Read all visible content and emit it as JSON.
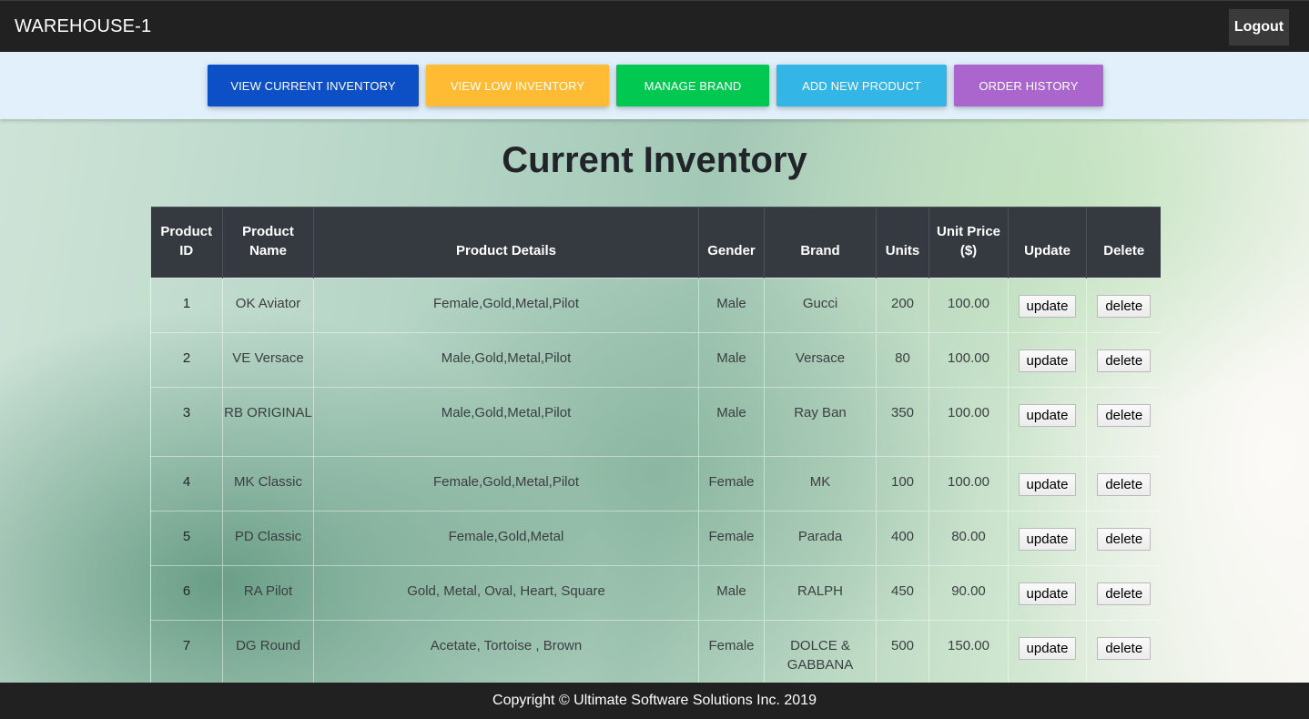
{
  "header": {
    "brand": "WAREHOUSE-1",
    "logout_label": "Logout"
  },
  "actions": {
    "view_current_inventory": "VIEW CURRENT INVENTORY",
    "view_low_inventory": "VIEW LOW INVENTORY",
    "manage_brand": "MANAGE BRAND",
    "add_new_product": "ADD NEW PRODUCT",
    "order_history": "ORDER HISTORY",
    "colors": {
      "view_current_inventory": "#0d4fc4",
      "view_low_inventory": "#ffbb33",
      "manage_brand": "#00c851",
      "add_new_product": "#33b5e5",
      "order_history": "#aa66cc"
    }
  },
  "page": {
    "title": "Current Inventory"
  },
  "table": {
    "headers": {
      "id_line1": "Product",
      "id_line2": "ID",
      "name_line1": "Product",
      "name_line2": "Name",
      "details": "Product Details",
      "gender": "Gender",
      "brand": "Brand",
      "units": "Units",
      "price_line1": "Unit Price",
      "price_line2": "($)",
      "update": "Update",
      "delete": "Delete"
    },
    "update_label": "update",
    "delete_label": "delete",
    "rows": [
      {
        "id": "1",
        "name": "OK Aviator",
        "details": "Female,Gold,Metal,Pilot",
        "gender": "Male",
        "brand": "Gucci",
        "units": "200",
        "price": "100.00"
      },
      {
        "id": "2",
        "name": "VE Versace",
        "details": "Male,Gold,Metal,Pilot",
        "gender": "Male",
        "brand": "Versace",
        "units": "80",
        "price": "100.00"
      },
      {
        "id": "3",
        "name": "RB ORIGINAL",
        "details": "Male,Gold,Metal,Pilot",
        "gender": "Male",
        "brand": "Ray Ban",
        "units": "350",
        "price": "100.00"
      },
      {
        "id": "4",
        "name": "MK Classic",
        "details": "Female,Gold,Metal,Pilot",
        "gender": "Female",
        "brand": "MK",
        "units": "100",
        "price": "100.00"
      },
      {
        "id": "5",
        "name": "PD Classic",
        "details": "Female,Gold,Metal",
        "gender": "Female",
        "brand": "Parada",
        "units": "400",
        "price": "80.00"
      },
      {
        "id": "6",
        "name": "RA Pilot",
        "details": "Gold, Metal, Oval, Heart, Square",
        "gender": "Male",
        "brand": "RALPH",
        "units": "450",
        "price": "90.00"
      },
      {
        "id": "7",
        "name": "DG Round",
        "details": "Acetate, Tortoise , Brown",
        "gender": "Female",
        "brand": "DOLCE & GABBANA",
        "units": "500",
        "price": "150.00"
      }
    ]
  },
  "footer": {
    "copyright": "Copyright © Ultimate Software Solutions Inc. 2019"
  }
}
